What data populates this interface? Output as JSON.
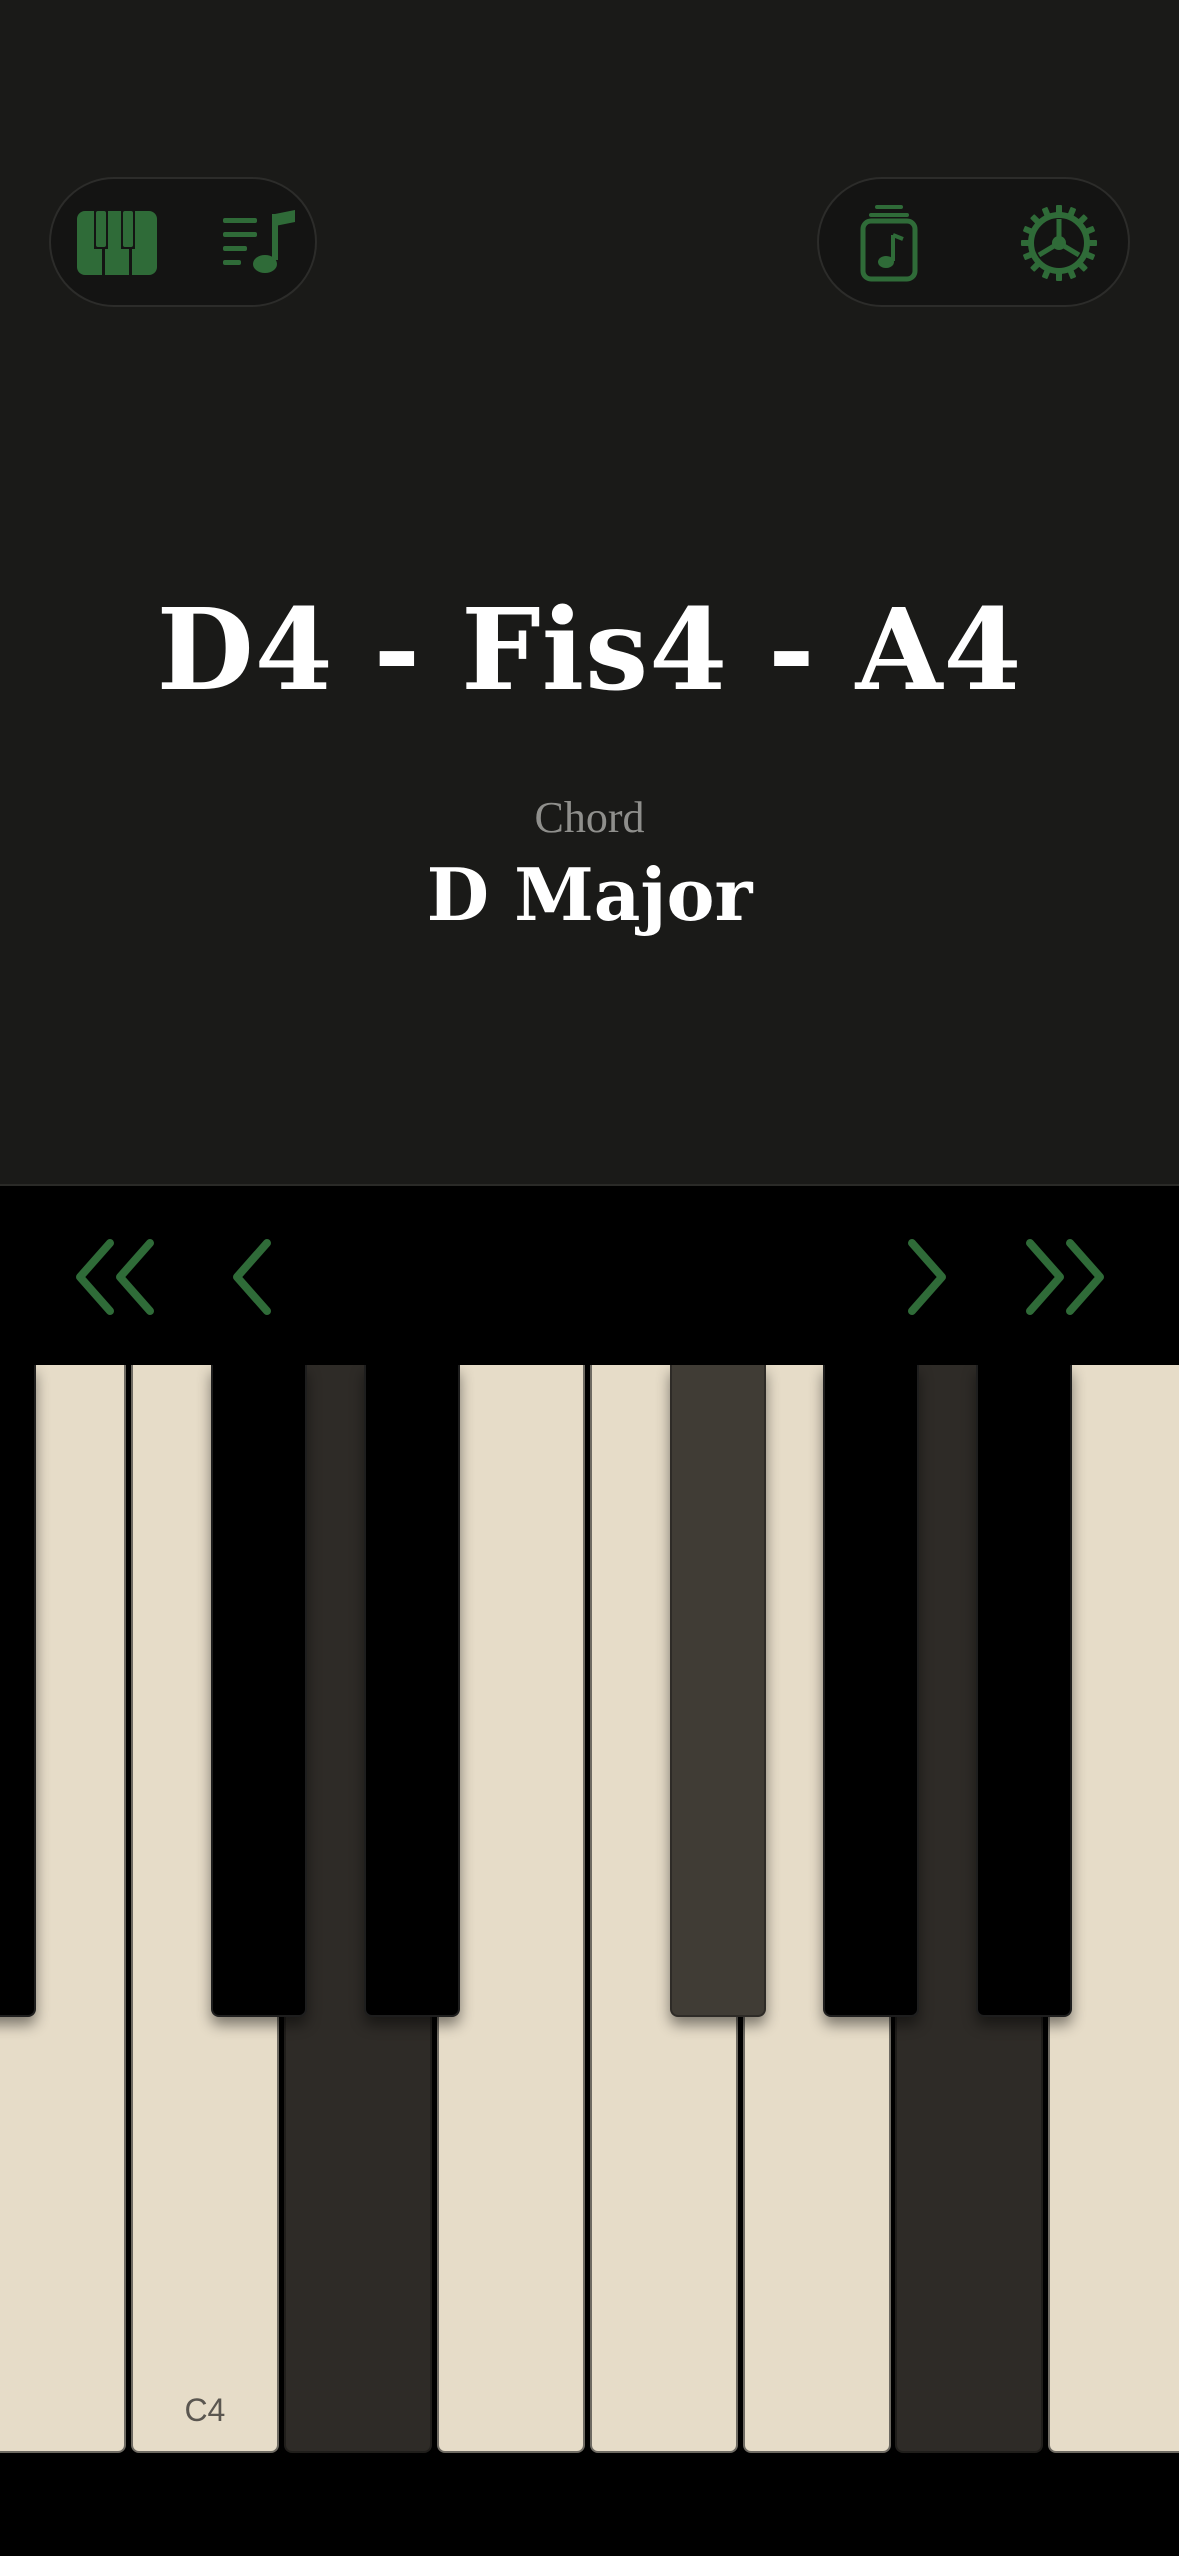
{
  "toolbar": {
    "left_icons": [
      "piano-keys-icon",
      "music-list-icon"
    ],
    "right_icons": [
      "sound-library-icon",
      "settings-gear-icon"
    ],
    "accent_color": "#2f6b38"
  },
  "display": {
    "notes": "D4 - Fis4 - A4",
    "chord_label": "Chord",
    "chord_name": "D Major"
  },
  "navigation": {
    "icons": [
      "double-chevron-left-icon",
      "chevron-left-icon",
      "chevron-right-icon",
      "double-chevron-right-icon"
    ]
  },
  "keyboard": {
    "white_keys": [
      {
        "note": "B3",
        "label": "",
        "pressed": false
      },
      {
        "note": "C4",
        "label": "C4",
        "pressed": false
      },
      {
        "note": "D4",
        "label": "",
        "pressed": true
      },
      {
        "note": "E4",
        "label": "",
        "pressed": false
      },
      {
        "note": "F4",
        "label": "",
        "pressed": false
      },
      {
        "note": "G4",
        "label": "",
        "pressed": false
      },
      {
        "note": "A4",
        "label": "",
        "pressed": true
      },
      {
        "note": "B4",
        "label": "",
        "pressed": false
      }
    ],
    "black_keys": [
      {
        "note": "A#3",
        "pressed": false
      },
      {
        "note": "C#4",
        "pressed": false
      },
      {
        "note": "D#4",
        "pressed": false
      },
      {
        "note": "F#4",
        "pressed": true
      },
      {
        "note": "G#4",
        "pressed": false
      },
      {
        "note": "A#4",
        "pressed": false
      }
    ],
    "colors": {
      "white": "#e6dcc8",
      "white_pressed": "#2e2b27",
      "black": "#000000",
      "black_pressed": "#403c35"
    }
  }
}
